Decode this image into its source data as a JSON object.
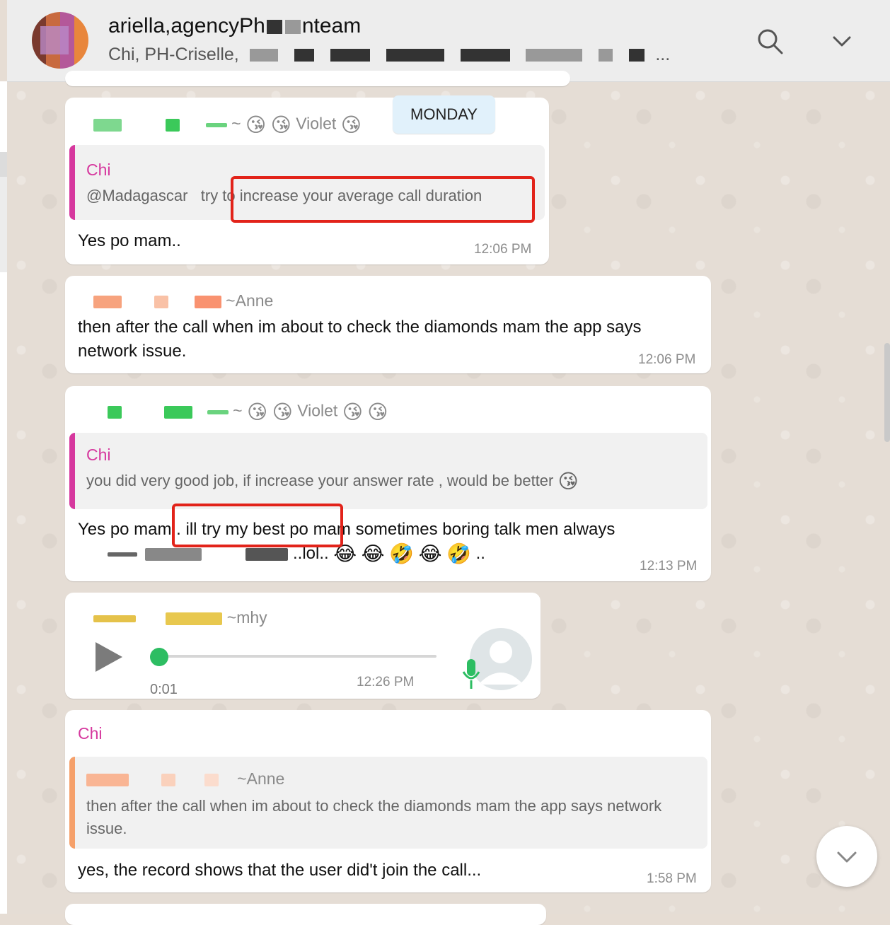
{
  "header": {
    "group_title": "ariella,agencyPh",
    "group_title_end": "nteam",
    "members": "Chi, PH-Criselle,",
    "members_tail": "...",
    "search_icon": "search-icon",
    "menu_icon": "chevron-down-icon"
  },
  "date_pill": "MONDAY",
  "messages": [
    {
      "sender_name": "~ ",
      "sender_display": "Violet",
      "quote_name": "Chi",
      "quote_text_a": "@Madagascar",
      "quote_text_b": "try to increase your average call duration",
      "text": "Yes po mam..",
      "time": "12:06 PM"
    },
    {
      "sender_display": "~Anne",
      "text": "then after the call when im about to check the diamonds mam the app says network issue.",
      "time": "12:06 PM"
    },
    {
      "sender_name": "~ ",
      "sender_display": "Violet",
      "quote_name": "Chi",
      "quote_text": "you did very good job, if increase your answer rate , would be better",
      "text_line1": "Yes po mam.. ill try my best po mam sometimes boring talk men always",
      "text_line2": "..lol..",
      "text_line2_end": "..",
      "time": "12:13 PM"
    },
    {
      "sender_display": "~mhy",
      "duration": "0:01",
      "time": "12:26 PM"
    },
    {
      "sender_display": "Chi",
      "quote_name": "~Anne",
      "quote_text": "then after the call when im about to check the diamonds mam the app says network issue.",
      "text": "yes, the record shows that the user did't join the call...",
      "time": "1:58 PM"
    }
  ],
  "emojis": {
    "kiss": "😘",
    "joy": "😂",
    "rofl": "🤣"
  },
  "colors": {
    "quote_pink": "#d6389e",
    "quote_orange": "#f5a06a",
    "highlight_red": "#e2231a",
    "voice_green": "#2dbd62"
  }
}
